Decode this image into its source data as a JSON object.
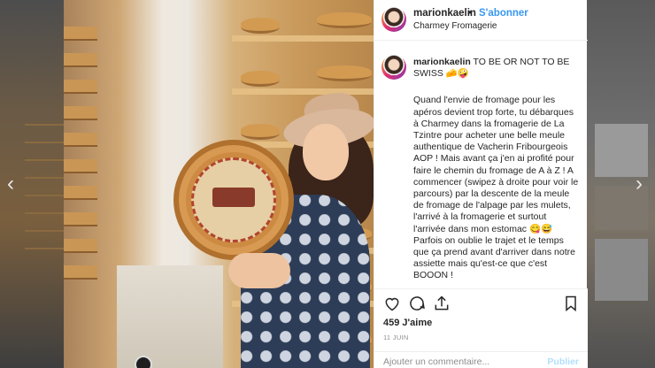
{
  "nav": {
    "prev_glyph": "‹",
    "next_glyph": "›"
  },
  "post": {
    "author": {
      "username": "marionkaelin",
      "separator": "•",
      "follow_label": "S'abonner",
      "location": "Charmey Fromagerie"
    },
    "caption": {
      "username": "marionkaelin",
      "headline": "TO BE OR NOT TO BE SWISS 🧀🤪",
      "body": "Quand l'envie de fromage pour les apéros devient trop forte, tu débarques à Charmey dans la fromagerie de La Tzintre pour acheter une belle meule authentique de Vacherin Fribourgeois AOP ! Mais avant ça j'en ai profité pour faire le chemin du fromage de A à Z ! A commencer (swipez à droite pour voir le parcours) par la descente de la meule de fromage de l'alpage par les mulets, l'arrivé à la fromagerie et surtout l'arrivée dans mon estomac 😋😅 Parfois on oublie le trajet et le temps que ça prend avant d'arriver dans notre assiette mais qu'est-ce que c'est BOOON !"
    },
    "likes": "459 J'aime",
    "date": "11 JUIN",
    "comment": {
      "placeholder": "Ajouter un commentaire...",
      "value": "",
      "publish_label": "Publier"
    }
  },
  "colors": {
    "accent": "#3897f0",
    "publish_disabled": "#b2dffc",
    "text": "#262626",
    "muted": "#8e8e8e"
  },
  "icons": [
    "chevron-left-icon",
    "chevron-right-icon",
    "heart-icon",
    "comment-icon",
    "share-icon",
    "bookmark-icon",
    "user-tag-icon"
  ]
}
